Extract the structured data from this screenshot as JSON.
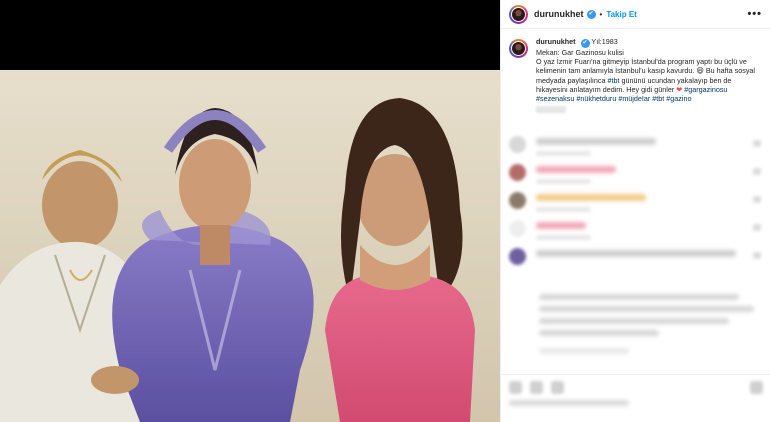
{
  "post": {
    "username": "durunukhet",
    "follow_label": "Takip Et",
    "more_label": "•••",
    "separator": "•",
    "verified_mark": "✔"
  },
  "caption": {
    "username": "durunukhet",
    "verified_mark": "✔",
    "text_1": "Yıl:1983",
    "text_2": "Mekan: Gar Gazinosu kulisi",
    "text_3": "O yaz İzmir Fuarı'na gitmeyip İstanbul'da program yaptı bu üçlü ve kelimenin tam anlamıyla İstanbul'u kasıp kavurdu. 😄 Bu hafta sosyal medyada paylaşılınca ",
    "tag_tbt": "#tbt",
    "text_4": " gününü ucundan yakalayıp ben de hikayesini anlatayım dedim. Hey gidi günler ",
    "heart": "❤",
    "tags": "#gargazinosu #sezenaksu #nükhetduru #müjdeIar #tbt #gazino"
  },
  "icons": {
    "avatar": "avatar-icon",
    "verified": "verified-badge-icon",
    "more": "more-options-icon",
    "like": "heart-icon",
    "comment": "comment-icon",
    "share": "share-icon",
    "save": "bookmark-icon"
  },
  "colors": {
    "follow": "#0095f6",
    "hashtag": "#00376b",
    "heart": "#ed4956",
    "verified": "#3897f0"
  }
}
